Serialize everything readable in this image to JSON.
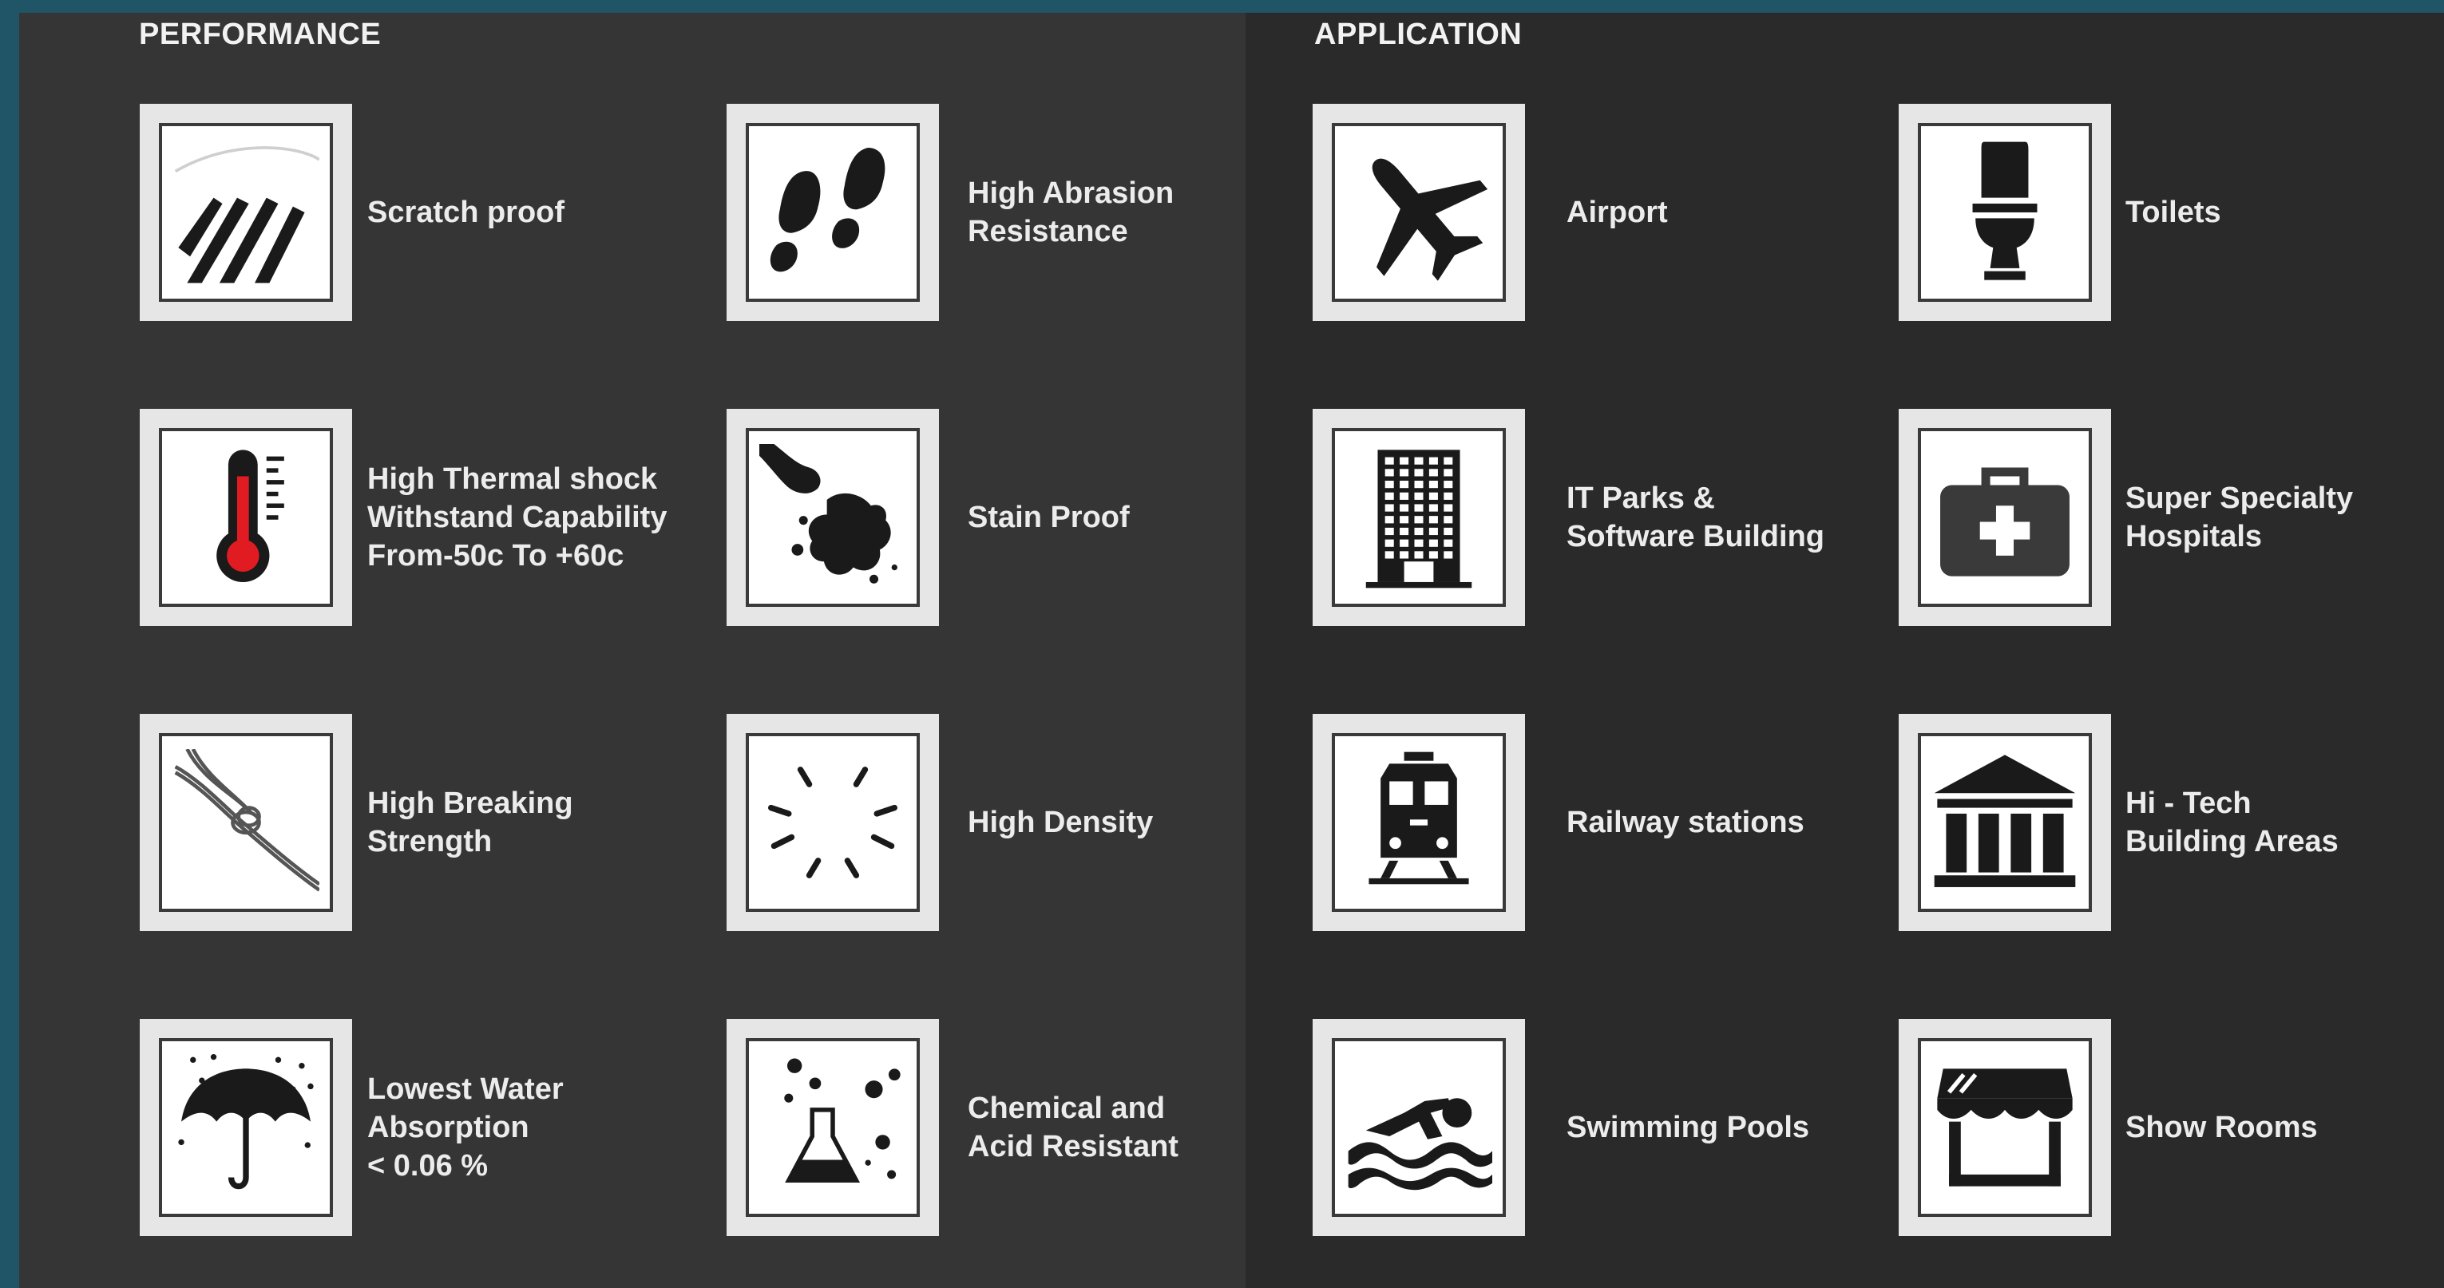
{
  "performance": {
    "title": "PERFORMANCE",
    "items": [
      {
        "icon": "scratch-icon",
        "lines": [
          "Scratch proof"
        ]
      },
      {
        "icon": "footprints-icon",
        "lines": [
          "High Abrasion",
          "Resistance"
        ]
      },
      {
        "icon": "thermometer-icon",
        "lines": [
          "High Thermal shock",
          "Withstand Capability",
          "From-50c To +60c"
        ]
      },
      {
        "icon": "stain-icon",
        "lines": [
          "Stain Proof"
        ]
      },
      {
        "icon": "rope-knot-icon",
        "lines": [
          "High Breaking",
          "Strength"
        ]
      },
      {
        "icon": "density-burst-icon",
        "lines": [
          "High Density"
        ]
      },
      {
        "icon": "umbrella-rain-icon",
        "lines": [
          "Lowest Water",
          "Absorption",
          "< 0.06 %"
        ]
      },
      {
        "icon": "flask-icon",
        "lines": [
          "Chemical and",
          "Acid Resistant"
        ]
      }
    ]
  },
  "application": {
    "title": "APPLICATION",
    "items": [
      {
        "icon": "airplane-icon",
        "lines": [
          "Airport"
        ]
      },
      {
        "icon": "toilet-icon",
        "lines": [
          "Toilets"
        ]
      },
      {
        "icon": "office-building-icon",
        "lines": [
          "IT Parks &",
          "Software Building"
        ]
      },
      {
        "icon": "first-aid-kit-icon",
        "lines": [
          "Super Specialty",
          "Hospitals"
        ]
      },
      {
        "icon": "train-icon",
        "lines": [
          "Railway stations"
        ]
      },
      {
        "icon": "classical-building-icon",
        "lines": [
          "Hi - Tech",
          "Building Areas"
        ]
      },
      {
        "icon": "swimmer-icon",
        "lines": [
          "Swimming Pools"
        ]
      },
      {
        "icon": "storefront-icon",
        "lines": [
          "Show Rooms"
        ]
      }
    ]
  },
  "colors": {
    "frame": "#1f5566",
    "panel_left": "#353535",
    "panel_right": "#2a2a2a",
    "text": "#ececec",
    "icon": "#1a1a1a",
    "thermometer_fill": "#e11b22"
  }
}
